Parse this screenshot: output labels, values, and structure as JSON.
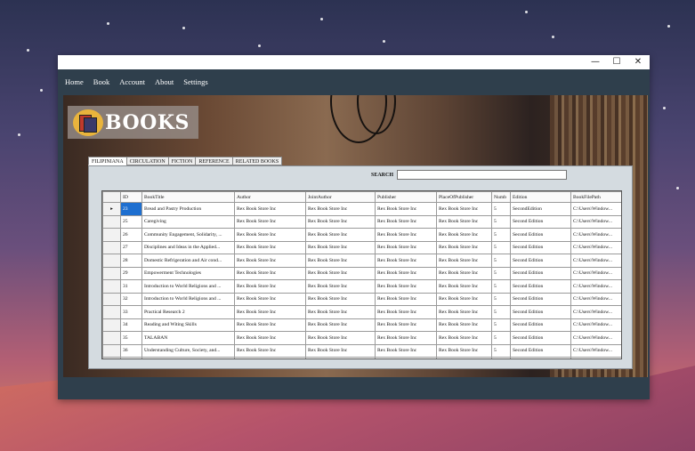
{
  "window": {
    "controls": {
      "minimize": "—",
      "maximize": "☐",
      "close": "✕"
    }
  },
  "menu": [
    "Home",
    "Book",
    "Account",
    "About",
    "Settings"
  ],
  "logo": {
    "text": "BOOKS"
  },
  "tabs": [
    "FILIPINIANA",
    "CIRCULATION",
    "FICTION",
    "REFERENCE",
    "RELATED BOOKS"
  ],
  "active_tab": "FILIPINIANA",
  "search": {
    "label": "SEARCH",
    "value": ""
  },
  "table": {
    "columns": [
      "",
      "ID",
      "BookTitle",
      "Author",
      "JointAuthor",
      "Publisher",
      "PlaceOfPublisher",
      "Numb",
      "Edition",
      "BookFilePath"
    ],
    "rows": [
      [
        "▸",
        "23",
        "Bread and Pastry Production",
        "Rex Book Store Inc",
        "Rex Book Store Inc",
        "Rex Book Store Inc",
        "Rex Book Store Inc",
        "5",
        "SecondEdition",
        "C:\\Users\\Window..."
      ],
      [
        "",
        "25",
        "Caregiving",
        "Rex Book Store Inc",
        "Rex Book Store Inc",
        "Rex Book Store Inc",
        "Rex Book Store Inc",
        "5",
        "Second Edition",
        "C:\\Users\\Window..."
      ],
      [
        "",
        "26",
        "Community Engagement, Solidarity, ...",
        "Rex Book Store Inc",
        "Rex Book Store Inc",
        "Rex Book Store Inc",
        "Rex Book Store Inc",
        "5",
        "Second Edition",
        "C:\\Users\\Window..."
      ],
      [
        "",
        "27",
        "Disciplines and Ideas in the Applied...",
        "Rex Book Store Inc",
        "Rex Book Store Inc",
        "Rex Book Store Inc",
        "Rex Book Store Inc",
        "5",
        "Second Edition",
        "C:\\Users\\Window..."
      ],
      [
        "",
        "28",
        "Domestic Refrigeration and Air cond...",
        "Rex Book Store Inc",
        "Rex Book Store Inc",
        "Rex Book Store Inc",
        "Rex Book Store Inc",
        "5",
        "Second Edition",
        "C:\\Users\\Window..."
      ],
      [
        "",
        "29",
        "Empowerment Technologies",
        "Rex Book Store Inc",
        "Rex Book Store Inc",
        "Rex Book Store Inc",
        "Rex Book Store Inc",
        "5",
        "Second Edition",
        "C:\\Users\\Window..."
      ],
      [
        "",
        "31",
        "Introduction to World Religions and ...",
        "Rex Book Store Inc",
        "Rex Book Store Inc",
        "Rex Book Store Inc",
        "Rex Book Store Inc",
        "5",
        "Second Edition",
        "C:\\Users\\Window..."
      ],
      [
        "",
        "32",
        "Introduction to World Religions and ...",
        "Rex Book Store Inc",
        "Rex Book Store Inc",
        "Rex Book Store Inc",
        "Rex Book Store Inc",
        "5",
        "Second Edition",
        "C:\\Users\\Window..."
      ],
      [
        "",
        "33",
        "Practical Research 2",
        "Rex Book Store Inc",
        "Rex Book Store Inc",
        "Rex Book Store Inc",
        "Rex Book Store Inc",
        "5",
        "Second Edition",
        "C:\\Users\\Window..."
      ],
      [
        "",
        "34",
        "Reading and Witing Skills",
        "Rex Book Store Inc",
        "Rex Book Store Inc",
        "Rex Book Store Inc",
        "Rex Book Store Inc",
        "5",
        "Second Edition",
        "C:\\Users\\Window..."
      ],
      [
        "",
        "35",
        "TALABAN",
        "Rex Book Store Inc",
        "Rex Book Store Inc",
        "Rex Book Store Inc",
        "Rex Book Store Inc",
        "5",
        "Second Edition",
        "C:\\Users\\Window..."
      ],
      [
        "",
        "36",
        "Understanding Culture, Society, and...",
        "Rex Book Store Inc",
        "Rex Book Store Inc",
        "Rex Book Store Inc",
        "Rex Book Store Inc",
        "5",
        "Second Edition",
        "C:\\Users\\Window..."
      ],
      [
        "*",
        "",
        "",
        "",
        "",
        "",
        "",
        "",
        "",
        ""
      ]
    ]
  }
}
